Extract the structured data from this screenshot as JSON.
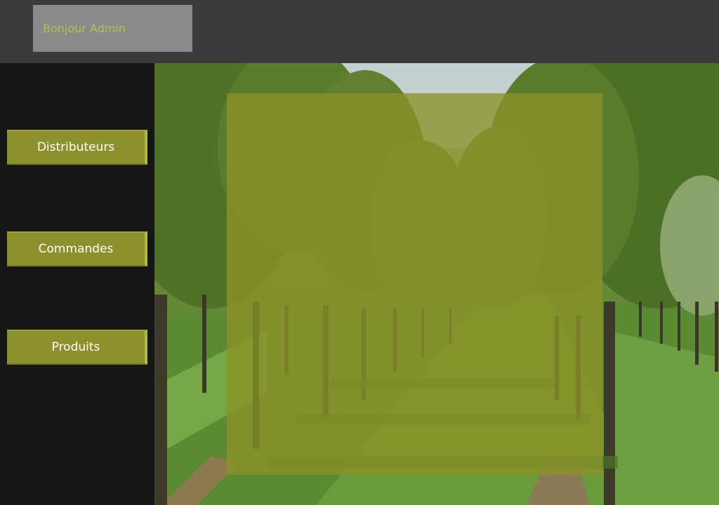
{
  "header": {
    "greeting": "Bonjour Admin"
  },
  "sidebar": {
    "items": [
      {
        "label": "Distributeurs"
      },
      {
        "label": "Commandes"
      },
      {
        "label": "Produits"
      }
    ]
  },
  "background": {
    "description_icon": "orchard-photo"
  },
  "colors": {
    "accent": "#8e902d",
    "topbar": "#3b3b3b",
    "sidebar": "#161616",
    "greeting_text": "#b7c04a"
  }
}
